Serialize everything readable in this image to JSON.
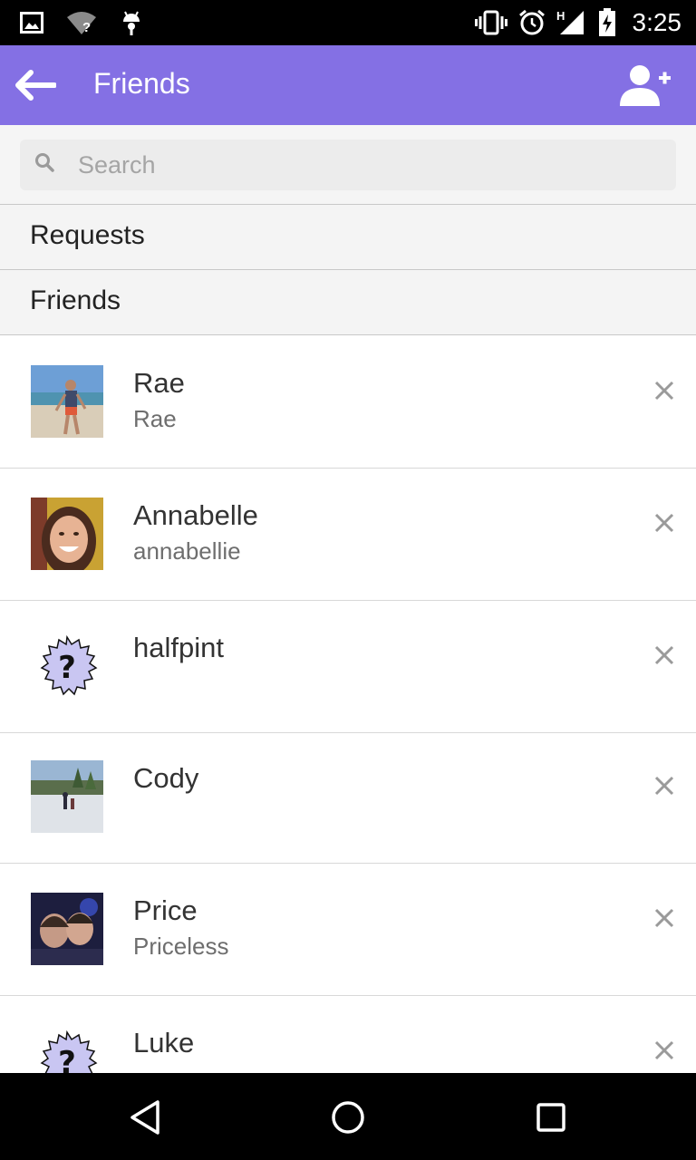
{
  "status_bar": {
    "time": "3:25",
    "left_icons": [
      "image-icon",
      "wifi-unknown-icon",
      "android-icon"
    ],
    "right_icons": [
      "vibrate-icon",
      "alarm-icon",
      "cell-signal-icon",
      "battery-charging-icon"
    ],
    "network_label": "H"
  },
  "app_bar": {
    "title": "Friends",
    "background_color": "#8470e4",
    "back_icon": "arrow-left-icon",
    "action_icon": "add-person-icon"
  },
  "search": {
    "placeholder": "Search",
    "value": ""
  },
  "sections": {
    "requests_label": "Requests",
    "friends_label": "Friends"
  },
  "friends": [
    {
      "name": "Rae",
      "username": "Rae",
      "avatar": "photo-beach"
    },
    {
      "name": "Annabelle",
      "username": "annabellie",
      "avatar": "photo-portrait"
    },
    {
      "name": "halfpint",
      "username": "",
      "avatar": "unknown-avatar-icon"
    },
    {
      "name": "Cody",
      "username": "",
      "avatar": "photo-ice-rink"
    },
    {
      "name": "Price",
      "username": "Priceless",
      "avatar": "photo-selfie-dark"
    },
    {
      "name": "Luke",
      "username": "",
      "avatar": "unknown-avatar-icon"
    }
  ],
  "nav_bar": {
    "icons": [
      "back-triangle-icon",
      "home-circle-icon",
      "recents-square-icon"
    ]
  }
}
